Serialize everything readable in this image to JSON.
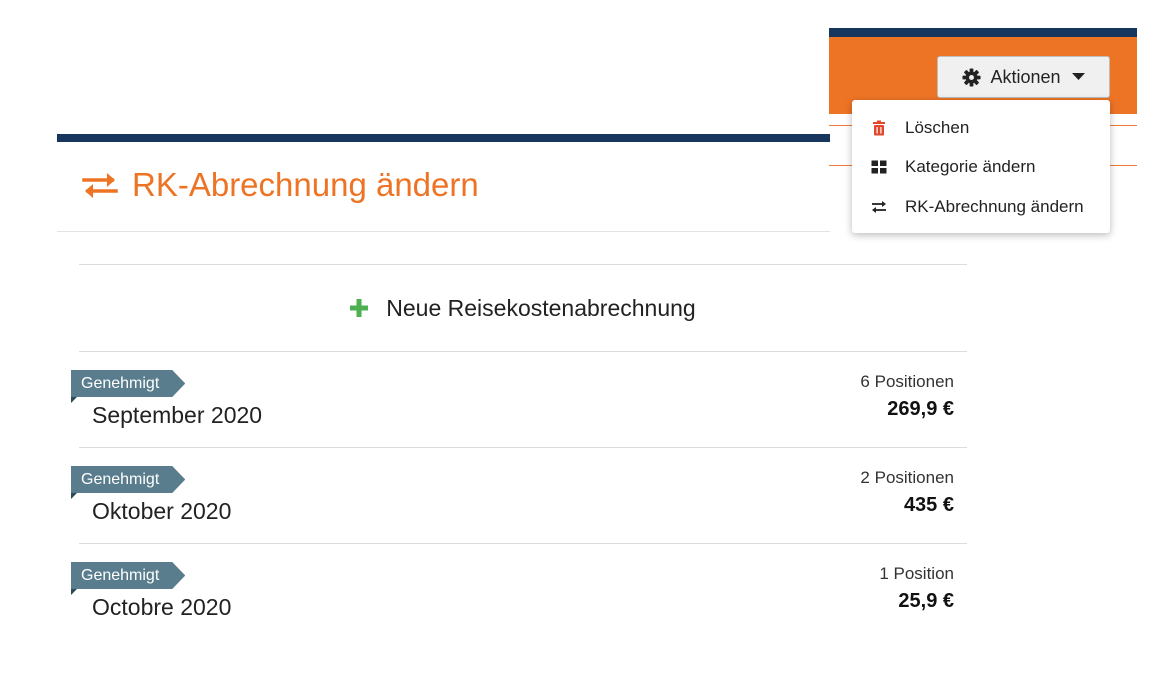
{
  "header": {
    "actions_button_label": "Aktionen",
    "accent_color": "#ee7425",
    "navy_color": "#17365d"
  },
  "actions_menu": {
    "items": [
      {
        "label": "Löschen",
        "icon": "trash-icon"
      },
      {
        "label": "Kategorie ändern",
        "icon": "grid-icon"
      },
      {
        "label": "RK-Abrechnung ändern",
        "icon": "swap-arrows-icon"
      }
    ]
  },
  "modal": {
    "title": "RK-Abrechnung ändern",
    "title_icon": "swap-arrows-icon",
    "new_label": "Neue Reisekostenabrechnung",
    "new_icon": "plus-icon",
    "badge_color": "#5a7d8d",
    "plus_color": "#4caf50"
  },
  "reports": [
    {
      "status": "Genehmigt",
      "title": "September 2020",
      "count": "6 Positionen",
      "amount": "269,9 €"
    },
    {
      "status": "Genehmigt",
      "title": "Oktober 2020",
      "count": "2 Positionen",
      "amount": "435 €"
    },
    {
      "status": "Genehmigt",
      "title": "Octobre 2020",
      "count": "1 Position",
      "amount": "25,9 €"
    }
  ]
}
